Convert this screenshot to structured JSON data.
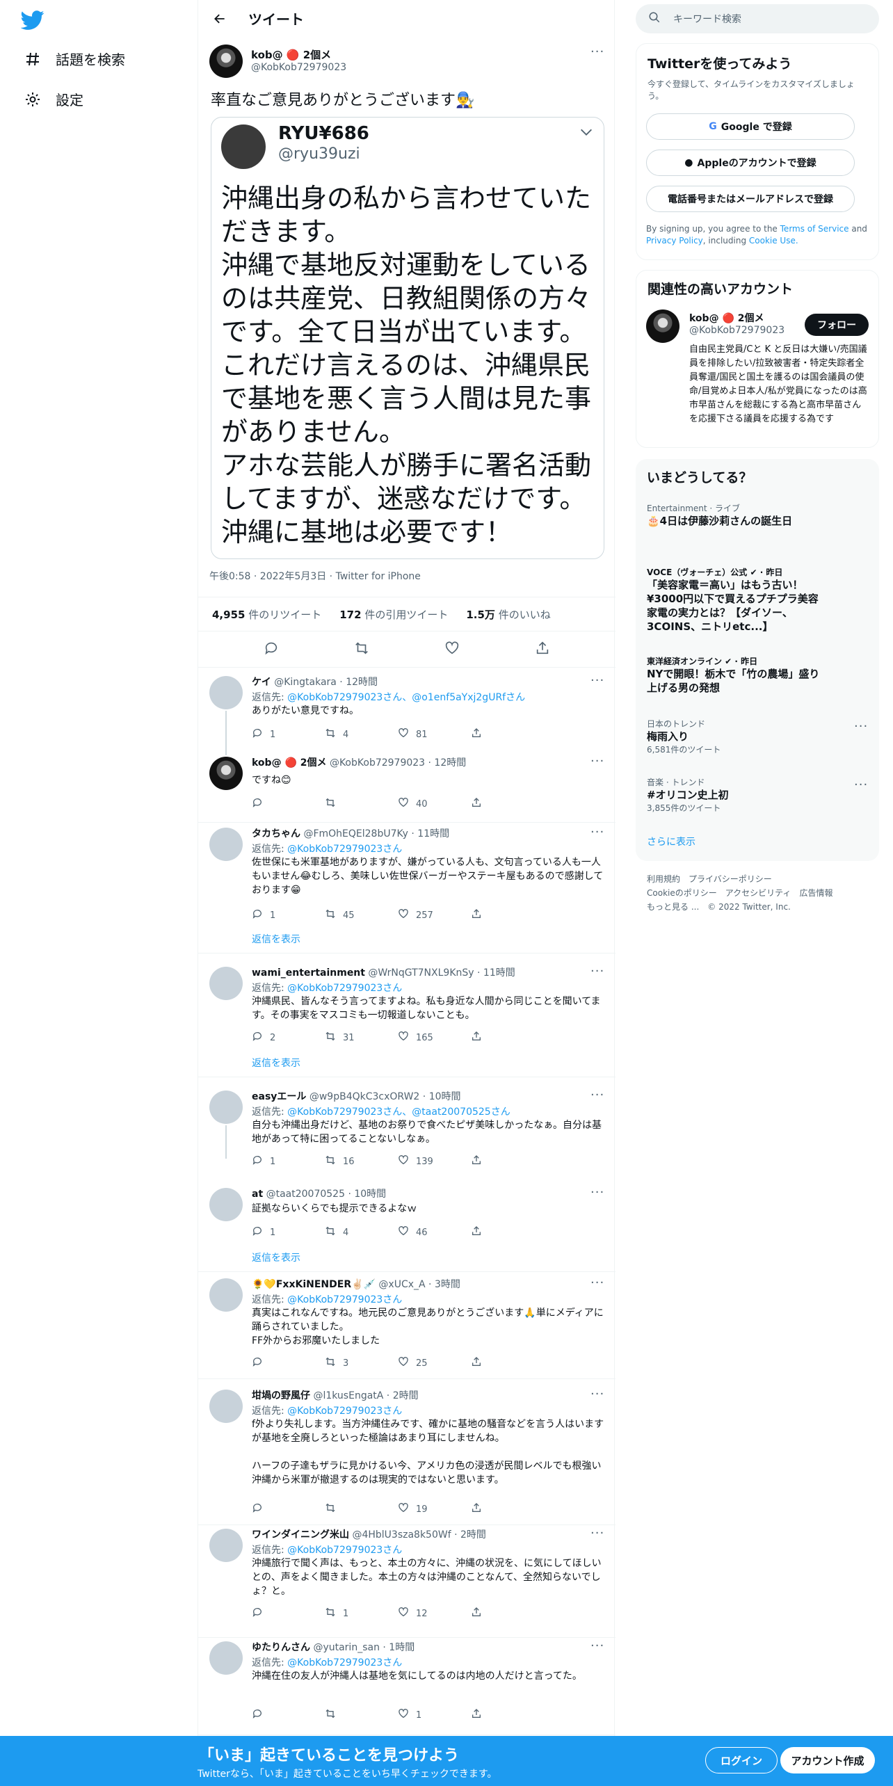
{
  "sidebar": {
    "explore_label": "話題を検索",
    "settings_label": "設定"
  },
  "header": {
    "title": "ツイート"
  },
  "tweet": {
    "name": "kob@ 🔴 2個メ",
    "handle": "@KobKob72979023",
    "text": "率直なご意見ありがとうございます👨‍🔧",
    "quote": {
      "name": "RYU¥686",
      "handle": "@ryu39uzi",
      "body": "沖縄出身の私から言わせていただきます。\n沖縄で基地反対運動をしているのは共産党、日教組関係の方々です。全て日当が出ています。\nこれだけ言えるのは、沖縄県民で基地を悪く言う人間は見た事がありません。\nアホな芸能人が勝手に署名活動してますが、迷惑なだけです。\n沖縄に基地は必要です！"
    },
    "timestamp": "午後0:58 · 2022年5月3日 · Twitter for iPhone",
    "retweets": "4,955",
    "retweets_label": "件のリツイート",
    "quotes": "172",
    "quotes_label": "件の引用ツイート",
    "likes": "1.5万",
    "likes_label": "件のいいね"
  },
  "replies": [
    {
      "name": "ケイ",
      "handle": "@Kingtakara · 12時間",
      "to_prefix": "返信先: ",
      "to": "@KobKob72979023さん、@o1enf5aYxj2gURfさん",
      "text": "ありがたい意見ですね。",
      "reply": "1",
      "rt": "4",
      "like": "81"
    },
    {
      "name": "kob@ 🔴 2個メ",
      "handle": "@KobKob72979023 · 12時間",
      "to": "",
      "text": "ですね😊",
      "reply": "",
      "rt": "",
      "like": "40"
    },
    {
      "name": "タカちゃん",
      "handle": "@FmOhEQEl28bU7Ky · 11時間",
      "to_prefix": "返信先: ",
      "to": "@KobKob72979023さん",
      "text": "佐世保にも米軍基地がありますが、嫌がっている人も、文句言っている人も一人もいません😂むしろ、美味しい佐世保バーガーやステーキ屋もあるので感謝しております😁",
      "reply": "1",
      "rt": "45",
      "like": "257"
    },
    {
      "name": "wami_entertainment",
      "handle": "@WrNqGT7NXL9KnSy · 11時間",
      "to_prefix": "返信先: ",
      "to": "@KobKob72979023さん",
      "text": "沖縄県民、皆んなそう言ってますよね。私も身近な人間から同じことを聞いてます。その事実をマスコミも一切報道しないことも。",
      "reply": "2",
      "rt": "31",
      "like": "165"
    },
    {
      "name": "easyエール",
      "handle": "@w9pB4QkC3cxORW2 · 10時間",
      "to_prefix": "返信先: ",
      "to": "@KobKob72979023さん、@taat20070525さん",
      "text": "自分も沖縄出身だけど、基地のお祭りで食べたピザ美味しかったなぁ。自分は基地があって特に困ってることないしなぁ。",
      "reply": "1",
      "rt": "16",
      "like": "139"
    },
    {
      "name": "at",
      "handle": "@taat20070525 · 10時間",
      "to": "",
      "text": "証拠ならいくらでも提示できるよなｗ",
      "reply": "1",
      "rt": "4",
      "like": "46"
    },
    {
      "name": "🌻💛FxxKiNENDER✌🏻💉",
      "handle": "@xUCx_A · 3時間",
      "to_prefix": "返信先: ",
      "to": "@KobKob72979023さん",
      "text": "真実はこれなんですね。地元民のご意見ありがとうございます🙏単にメディアに踊らされていました。\nFF外からお邪魔いたしました",
      "reply": "",
      "rt": "3",
      "like": "25"
    },
    {
      "name": "坩堝の野風仔",
      "handle": "@l1kusEngatA · 2時間",
      "to_prefix": "返信先: ",
      "to": "@KobKob72979023さん",
      "text": "f外より失礼します。当方沖縄住みです、確かに基地の騒音などを言う人はいますが基地を全廃しろといった極論はあまり耳にしませんね。\n\nハーフの子達もザラに見かけるい今、アメリカ色の浸透が民間レベルでも根強い沖縄から米軍が撤退するのは現実的ではないと思います。",
      "reply": "",
      "rt": "",
      "like": "19"
    },
    {
      "name": "ワインダイニング米山",
      "handle": "@4HblU3sza8k50Wf · 2時間",
      "to_prefix": "返信先: ",
      "to": "@KobKob72979023さん",
      "text": "沖縄旅行で聞く声は、もっと、本土の方々に、沖縄の状況を、に気にしてほしいとの、声をよく聞きました。本土の方々は沖縄のことなんて、全然知らないでしょ？と。",
      "reply": "",
      "rt": "1",
      "like": "12"
    },
    {
      "name": "ゆたりんさん",
      "handle": "@yutarin_san · 1時間",
      "to_prefix": "返信先: ",
      "to": "@KobKob72979023さん",
      "text": "沖縄在住の友人が沖縄人は基地を気にしてるのは内地の人だけと言ってた。",
      "reply": "",
      "rt": "",
      "like": "1"
    }
  ],
  "show_replies_label": "返信を表示",
  "right": {
    "search_placeholder": "キーワード検索",
    "signup": {
      "title": "Twitterを使ってみよう",
      "subtitle": "今すぐ登録して、タイムラインをカスタマイズしましょう。",
      "google": "Google で登録",
      "apple": "Appleのアカウントで登録",
      "phone": "電話番号またはメールアドレスで登録",
      "terms_pre": "By signing up, you agree to the ",
      "terms": "Terms of Service",
      "and": " and ",
      "privacy": "Privacy Policy",
      "including": ", including ",
      "cookie": "Cookie Use."
    },
    "related": {
      "title": "関連性の高いアカウント",
      "name": "kob@ 🔴 2個メ",
      "handle": "@KobKob72979023",
      "follow": "フォロー",
      "bio": "自由民主党員/Cと K と反日は大嫌い/売国議員を排除したい/拉致被害者・特定失踪者全員奪還/国民と国土を護るのは国会議員の使命/目覚めよ日本人/私が党員になったのは高市早苗さんを総裁にする為と高市早苗さんを応援下さる議員を応援する為です"
    },
    "trends": {
      "title": "いまどうしてる？",
      "items": [
        {
          "meta": "Entertainment · ライブ",
          "title": "🎂4日は伊藤沙莉さんの誕生日",
          "count": ""
        },
        {
          "meta": "VOCE（ヴォーチェ）公式 ✔ · 昨日",
          "title": "「美容家電＝高い」はもう古い！¥3000円以下で買えるプチプラ美容家電の実力とは？【ダイソー、3COINS、ニトリetc...】",
          "count": ""
        },
        {
          "meta": "東洋経済オンライン ✔ · 昨日",
          "title": "NYで開眼！栃木で「竹の農場」盛り上げる男の発想",
          "count": ""
        },
        {
          "meta": "日本のトレンド",
          "title": "梅雨入り",
          "count": "6,581件のツイート"
        },
        {
          "meta": "音楽 · トレンド",
          "title": "#オリコン史上初",
          "count": "3,855件のツイート"
        }
      ],
      "more": "さらに表示"
    },
    "footer": {
      "l1": "利用規約",
      "l2": "プライバシーポリシー",
      "l3": "Cookieのポリシー",
      "l4": "アクセシビリティ",
      "l5": "広告情報",
      "l6": "もっと見る ...",
      "copy": "© 2022 Twitter, Inc."
    }
  },
  "bottom": {
    "title": "「いま」起きていることを見つけよう",
    "subtitle": "Twitterなら、「いま」起きていることをいち早くチェックできます。",
    "login": "ログイン",
    "signup": "アカウント作成"
  },
  "colors": {
    "accent": "#1d9bf0",
    "text": "#0f1419",
    "muted": "#536471"
  }
}
